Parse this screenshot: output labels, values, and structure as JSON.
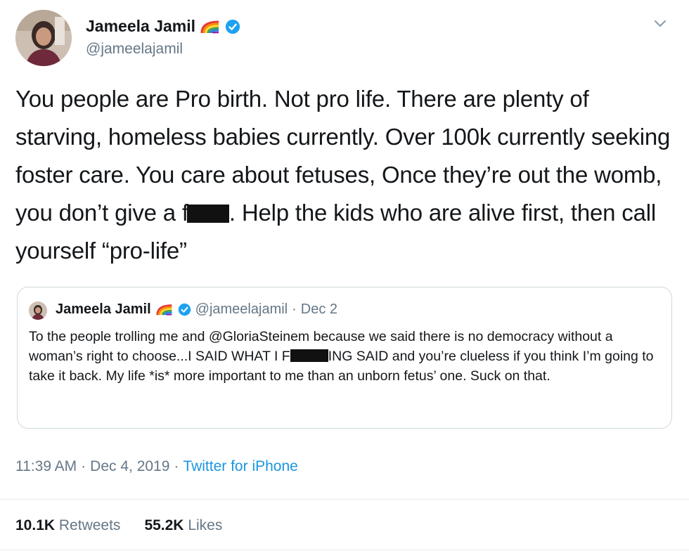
{
  "author": {
    "name": "Jameela Jamil",
    "handle": "@jameelajamil",
    "badge_icons": [
      "rainbow-flag-icon",
      "verified-badge-icon"
    ]
  },
  "tweet": {
    "text_part1": "You people are Pro birth. Not pro life. There are plenty of starving, homeless babies currently. Over 100k currently seeking foster care. You care about fetuses, Once they’re out the womb, you don’t give a f",
    "text_part2": ". Help the kids who are alive first, then call yourself “pro-life”"
  },
  "quoted": {
    "name": "Jameela Jamil",
    "handle": "@jameelajamil",
    "separator": "·",
    "date": "Dec 2",
    "text_part1": "To the people trolling me and @GloriaSteinem because we said there is no democracy without a woman’s right to choose...I SAID WHAT I F",
    "text_part2": "ING SAID and you’re clueless if you think I’m going to take it back. My life *is* more important to me than an unborn fetus’ one. Suck on that."
  },
  "meta": {
    "time": "11:39 AM",
    "separator": "·",
    "date": "Dec 4, 2019",
    "separator2": "·",
    "source": "Twitter for iPhone"
  },
  "stats": {
    "retweets_count": "10.1K",
    "retweets_label": "Retweets",
    "likes_count": "55.2K",
    "likes_label": "Likes"
  },
  "colors": {
    "verified_blue": "#1da1f2",
    "link_blue": "#1b95e0",
    "secondary_text": "#657786"
  }
}
